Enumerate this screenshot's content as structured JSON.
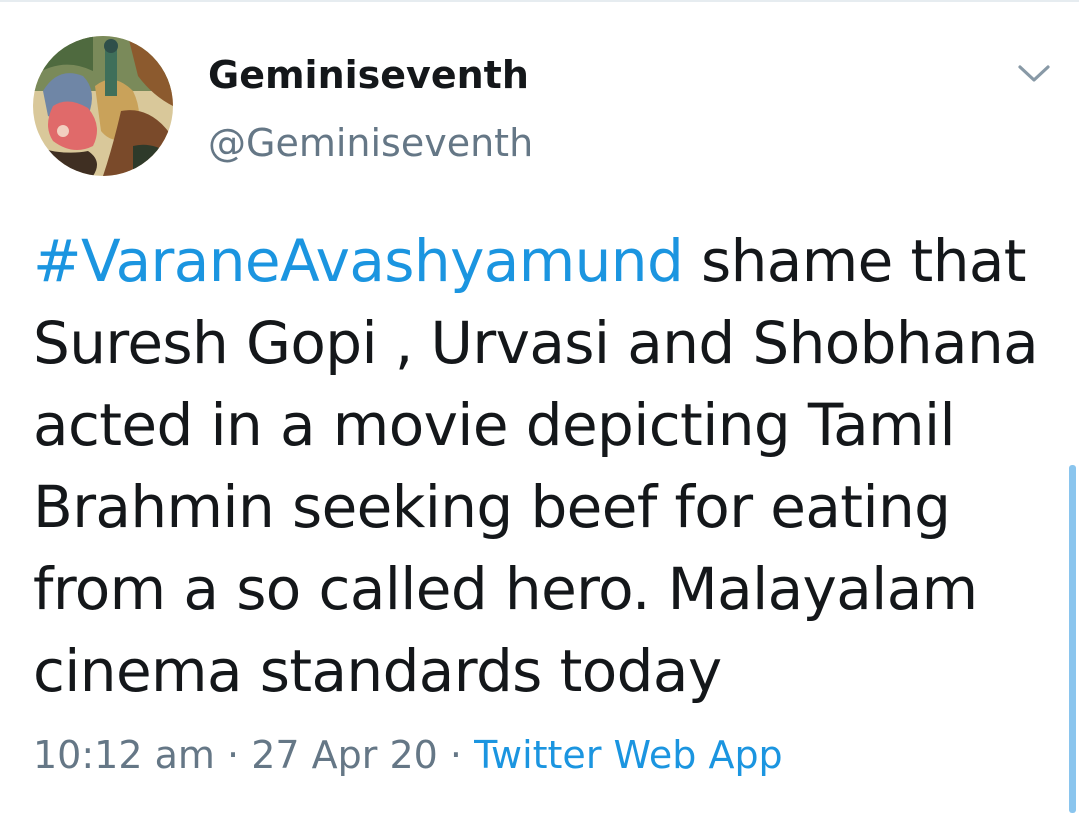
{
  "user": {
    "display_name": "Geminiseventh",
    "handle": "@Geminiseventh"
  },
  "tweet": {
    "hashtag": "#VaraneAvashyamund",
    "text_after_hashtag": " shame that Suresh Gopi , Urvasi and Shobhana acted in a movie depicting Tamil Brahmin seeking beef for eating from a so called hero. Malayalam cinema standards today"
  },
  "meta": {
    "time": "10:12 am",
    "separator": "·",
    "date": "27 Apr 20",
    "source": "Twitter Web App"
  },
  "icons": {
    "menu_caret": "chevron-down-icon"
  },
  "colors": {
    "link": "#1b95e0",
    "secondary_text": "#657786",
    "primary_text": "#14171a",
    "scrollbar": "#8ac5ee"
  }
}
